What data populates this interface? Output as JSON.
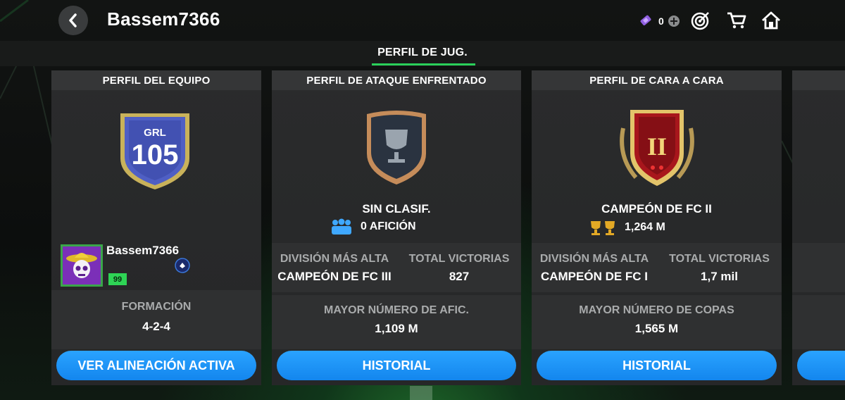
{
  "header": {
    "title": "Bassem7366",
    "currency_amount": "0"
  },
  "tabs": [
    {
      "label": "PERFIL DE JUG.",
      "active": true
    }
  ],
  "team_card": {
    "title": "PERFIL DEL EQUIPO",
    "ovr_label": "GRL",
    "ovr_value": "105",
    "username": "Bassem7366",
    "level": "99",
    "formation_label": "FORMACIÓN",
    "formation_value": "4-2-4",
    "button_label": "VER ALINEACIÓN ACTIVA"
  },
  "attack_card": {
    "title": "PERFIL DE ATAQUE ENFRENTADO",
    "rank": "SIN CLASIF.",
    "fans": "0 AFICIÓN",
    "highest_division_label": "DIVISIÓN MÁS ALTA",
    "highest_division_value": "CAMPEÓN DE FC III",
    "total_wins_label": "TOTAL VICTORIAS",
    "total_wins_value": "827",
    "record_label": "MAYOR NÚMERO DE AFIC.",
    "record_value": "1,109 M",
    "button_label": "HISTORIAL"
  },
  "h2h_card": {
    "title": "PERFIL DE CARA A CARA",
    "badge_numeral": "II",
    "rank": "CAMPEÓN DE FC II",
    "trophies": "1,264 M",
    "highest_division_label": "DIVISIÓN MÁS ALTA",
    "highest_division_value": "CAMPEÓN DE FC I",
    "total_wins_label": "TOTAL VICTORIAS",
    "total_wins_value": "1,7 mil",
    "record_label": "MAYOR NÚMERO DE COPAS",
    "record_value": "1,565 M",
    "button_label": "HISTORIAL"
  },
  "colors": {
    "accent_green": "#2ad05a",
    "button_blue": "#1c93f5",
    "card_bg": "#2a2b2c",
    "label_grey": "#a9abac"
  }
}
